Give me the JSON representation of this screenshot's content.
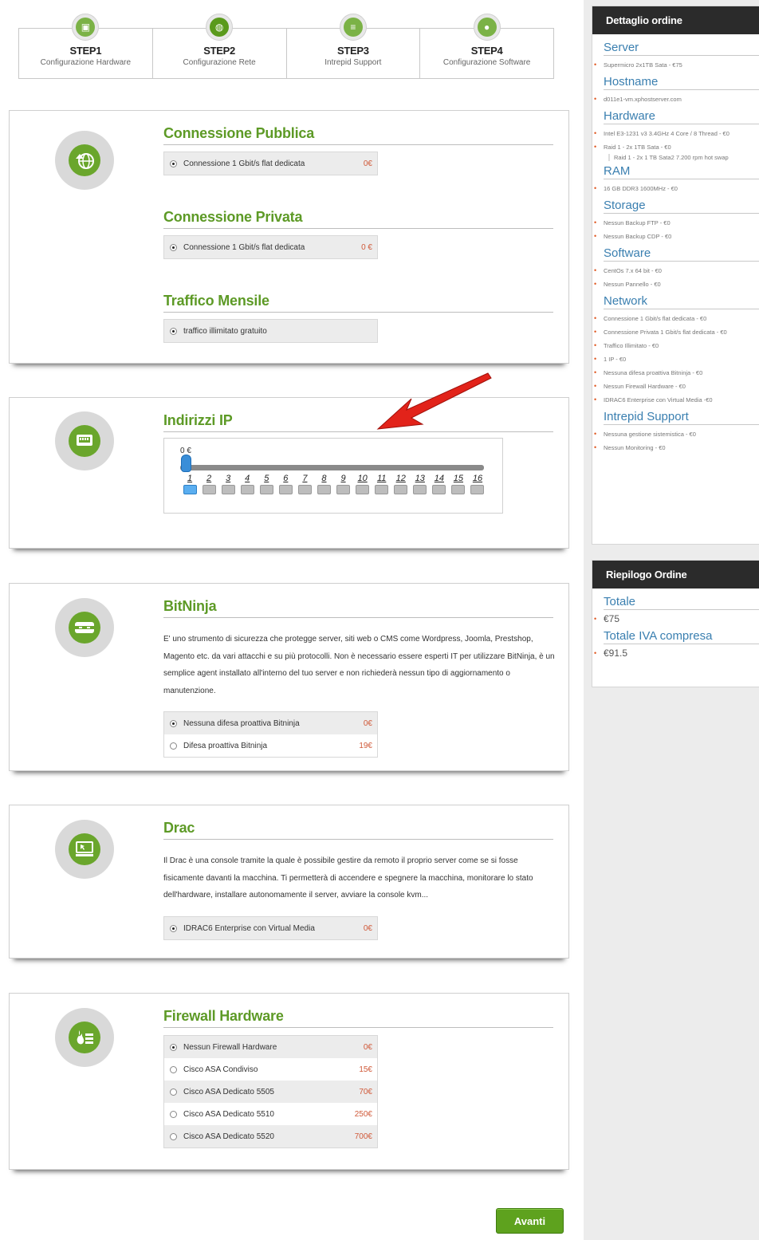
{
  "steps": [
    {
      "num": "STEP1",
      "desc": "Configurazione Hardware",
      "icon": "hardware-icon"
    },
    {
      "num": "STEP2",
      "desc": "Configurazione Rete",
      "icon": "network-globe-icon"
    },
    {
      "num": "STEP3",
      "desc": "Intrepid Support",
      "icon": "support-icon"
    },
    {
      "num": "STEP4",
      "desc": "Configurazione Software",
      "icon": "software-icon"
    }
  ],
  "network_card": {
    "public": {
      "title": "Connessione Pubblica",
      "options": [
        {
          "label": "Connessione 1 Gbit/s flat dedicata",
          "price": "0€",
          "selected": true
        }
      ]
    },
    "private": {
      "title": "Connessione Privata",
      "options": [
        {
          "label": "Connessione 1 Gbit/s flat dedicata",
          "price": "0 €",
          "selected": true
        }
      ]
    },
    "traffic": {
      "title": "Traffico Mensile",
      "options": [
        {
          "label": "traffico illimitato gratuito",
          "price": "",
          "selected": true
        }
      ]
    }
  },
  "ip_card": {
    "title": "Indirizzi IP",
    "value": "0 €",
    "ticks": [
      "1",
      "2",
      "3",
      "4",
      "5",
      "6",
      "7",
      "8",
      "9",
      "10",
      "11",
      "12",
      "13",
      "14",
      "15",
      "16"
    ],
    "selected_count": 1
  },
  "bitninja_card": {
    "title": "BitNinja",
    "description": "E' uno strumento di sicurezza che protegge server, siti web o CMS come Wordpress, Joomla, Prestshop, Magento etc. da vari attacchi e su più protocolli. Non è necessario essere esperti IT per utilizzare BitNinja, è un semplice agent installato all'interno del tuo server e non richiederà nessun tipo di aggiornamento o manutenzione.",
    "options": [
      {
        "label": "Nessuna difesa proattiva Bitninja",
        "price": "0€",
        "selected": true
      },
      {
        "label": "Difesa proattiva Bitninja",
        "price": "19€",
        "selected": false
      }
    ]
  },
  "drac_card": {
    "title": "Drac",
    "description": "Il Drac è una console tramite la quale è possibile gestire da remoto il proprio server come se si fosse fisicamente davanti la macchina. Ti permetterà di accendere e spegnere la macchina, monitorare lo stato dell'hardware, installare autonomamente il server, avviare la console kvm...",
    "options": [
      {
        "label": "IDRAC6 Enterprise con Virtual Media",
        "price": "0€",
        "selected": true
      }
    ]
  },
  "firewall_card": {
    "title": "Firewall Hardware",
    "options": [
      {
        "label": "Nessun Firewall Hardware",
        "price": "0€",
        "selected": true
      },
      {
        "label": "Cisco ASA Condiviso",
        "price": "15€",
        "selected": false
      },
      {
        "label": "Cisco ASA Dedicato 5505",
        "price": "70€",
        "selected": false
      },
      {
        "label": "Cisco ASA Dedicato 5510",
        "price": "250€",
        "selected": false
      },
      {
        "label": "Cisco ASA Dedicato 5520",
        "price": "700€",
        "selected": false
      }
    ]
  },
  "next_button": "Avanti",
  "order_detail": {
    "header": "Dettaglio ordine",
    "sections": [
      {
        "title": "Server",
        "items": [
          "Supermicro 2x1TB Sata - €75"
        ]
      },
      {
        "title": "Hostname",
        "items": [
          "d011e1-vm.xphostserver.com"
        ]
      },
      {
        "title": "Hardware",
        "items": [
          "Intel E3-1231 v3 3.4GHz 4 Core / 8 Thread - €0",
          "Raid 1 - 2x 1TB Sata - €0"
        ],
        "sub": "Raid 1 - 2x 1 TB Sata2 7.200 rpm hot swap"
      },
      {
        "title": "RAM",
        "items": [
          "16 GB DDR3 1600MHz - €0"
        ]
      },
      {
        "title": "Storage",
        "items": [
          "Nessun Backup FTP - €0",
          "Nessun Backup CDP - €0"
        ]
      },
      {
        "title": "Software",
        "items": [
          "CentOs 7.x 64 bit - €0",
          "Nessun Pannello - €0"
        ]
      },
      {
        "title": "Network",
        "items": [
          "Connessione 1 Gbit/s flat dedicata - €0",
          "Connessione Privata 1 Gbit/s flat dedicata - €0",
          "Traffico Illimitato - €0",
          "1 IP - €0",
          "Nessuna difesa proattiva Bitninja - €0",
          "Nessun Firewall Hardware - €0",
          "IDRAC6 Enterprise con Virtual Media -€0"
        ]
      },
      {
        "title": "Intrepid Support",
        "items": [
          "Nessuna gestione sistemistica - €0",
          "Nessun Monitoring - €0"
        ]
      }
    ]
  },
  "order_summary": {
    "header": "Riepilogo Ordine",
    "sections": [
      {
        "title": "Totale",
        "items": [
          "€75"
        ]
      },
      {
        "title": "Totale IVA compresa",
        "items": [
          "€91.5"
        ]
      }
    ]
  },
  "colors": {
    "accent_green": "#5d9a26",
    "link_blue": "#3a7fb0",
    "price_red": "#d05a3a",
    "dark_header": "#2b2b2b"
  }
}
